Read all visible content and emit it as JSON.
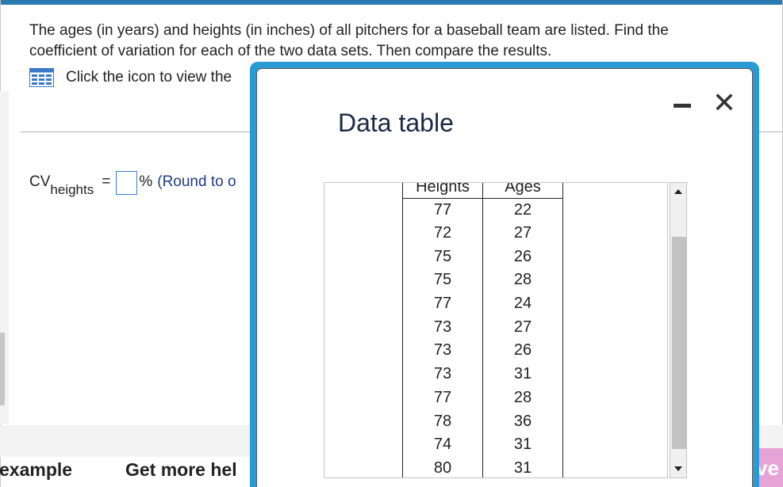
{
  "question": {
    "line1": "The ages (in years) and heights (in inches) of all pitchers for a baseball team are listed. Find the",
    "line2": "coefficient of variation for each of the two data sets. Then compare the results."
  },
  "icon_link": {
    "icon": "table-icon",
    "text": "Click the icon to view the"
  },
  "cv": {
    "label": "CV",
    "subscript": "heights",
    "equals": "=",
    "input_value": "",
    "percent": "%",
    "hint": "(Round to o"
  },
  "footer": {
    "example": "example",
    "help": "Get more hel",
    "right_button": "ve"
  },
  "dialog": {
    "title": "Data table",
    "minimize_icon": "minimize-icon",
    "close_icon": "close-icon",
    "close_glyph": "✕",
    "columns": [
      "Heights",
      "Ages"
    ],
    "rows": [
      [
        "77",
        "22"
      ],
      [
        "72",
        "27"
      ],
      [
        "75",
        "26"
      ],
      [
        "75",
        "28"
      ],
      [
        "77",
        "24"
      ],
      [
        "73",
        "27"
      ],
      [
        "73",
        "26"
      ],
      [
        "73",
        "31"
      ],
      [
        "77",
        "28"
      ],
      [
        "78",
        "36"
      ],
      [
        "74",
        "31"
      ],
      [
        "80",
        "31"
      ]
    ]
  },
  "colors": {
    "accent": "#2a9ad6",
    "top_bar": "#2a7ab0",
    "hint_text": "#1f3c88",
    "input_border": "#3b7bd6",
    "pink_button": "#e6a3d6"
  }
}
